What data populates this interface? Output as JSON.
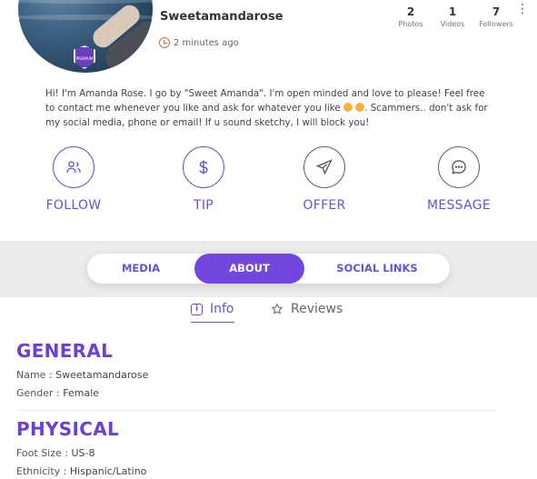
{
  "profile": {
    "username": "Sweetamandarose",
    "last_seen": "2 minutes ago",
    "badge_text": "PREMIUM",
    "stats": [
      {
        "value": "2",
        "label": "Photos"
      },
      {
        "value": "1",
        "label": "Videos"
      },
      {
        "value": "7",
        "label": "Followers"
      }
    ],
    "bio_part1": "Hi! I'm Amanda Rose. I go by \"Sweet Amanda\". I'm open minded and love to please! Feel free to contact me whenever you like and ask for whatever you like ",
    "bio_part2": ". Scammers.. don't ask for my social media, phone or email! If u sound sketchy, I will block you!"
  },
  "actions": [
    {
      "label": "FOLLOW",
      "icon": "follow-icon"
    },
    {
      "label": "TIP",
      "icon": "dollar-icon"
    },
    {
      "label": "OFFER",
      "icon": "send-icon"
    },
    {
      "label": "MESSAGE",
      "icon": "chat-icon"
    }
  ],
  "tabs": [
    {
      "label": "MEDIA"
    },
    {
      "label": "ABOUT",
      "active": true
    },
    {
      "label": "SOCIAL LINKS"
    }
  ],
  "subtabs": [
    {
      "label": "Info",
      "icon": "info-icon",
      "active": true
    },
    {
      "label": "Reviews",
      "icon": "star-icon"
    }
  ],
  "general": {
    "title": "GENERAL",
    "name_key": "Name :",
    "name_value": "Sweetamandarose",
    "gender_key": "Gender :",
    "gender_value": "Female"
  },
  "physical": {
    "title": "PHYSICAL",
    "foot_key": "Foot Size :",
    "foot_value": "US-8",
    "ethnicity_key": "Ethnicity :",
    "ethnicity_value": "Hispanic/Latino"
  },
  "colors": {
    "accent": "#6b4fd8",
    "active_tab": "#7147e0",
    "clock": "#e8643a"
  }
}
